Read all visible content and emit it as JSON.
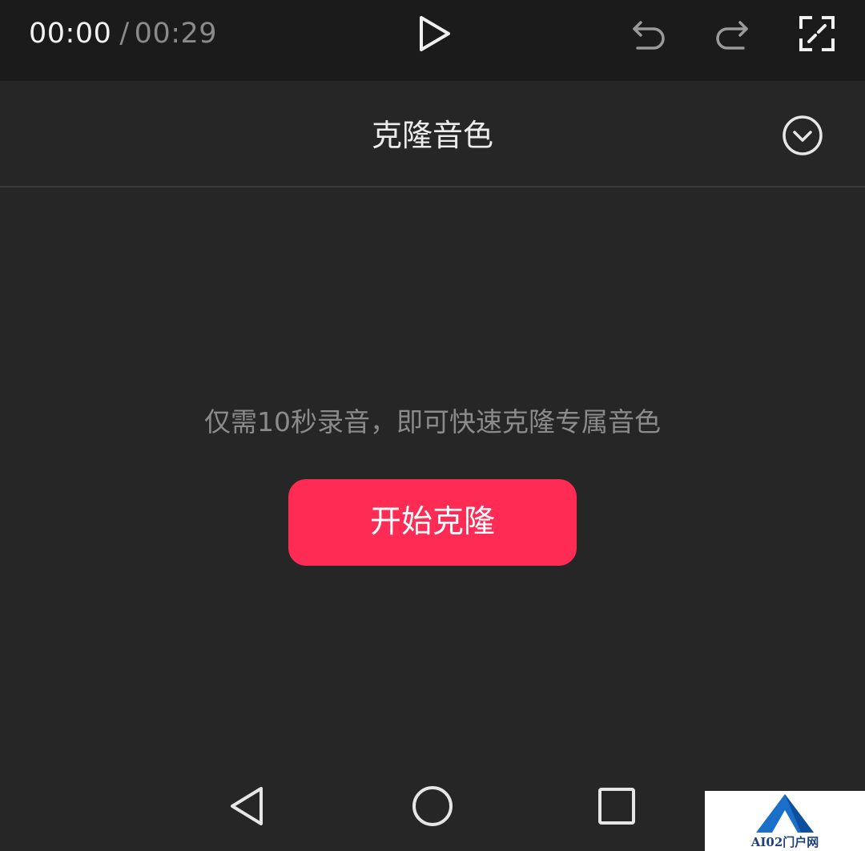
{
  "toolbar": {
    "current_time": "00:00",
    "separator": "/",
    "duration": "00:29",
    "icons": {
      "play": "play-icon",
      "undo": "undo-icon",
      "redo": "redo-icon",
      "fullscreen": "fullscreen-icon"
    }
  },
  "header": {
    "title": "克隆音色",
    "collapse_icon": "chevron-down-circle-icon"
  },
  "main": {
    "hint": "仅需10秒录音，即可快速克隆专属音色",
    "start_button_label": "开始克隆"
  },
  "navbar": {
    "back_icon": "back-triangle-icon",
    "home_icon": "home-circle-icon",
    "recent_icon": "recent-square-icon"
  },
  "watermark": {
    "text": "AI02门户网"
  },
  "colors": {
    "toolbar_bg": "#1b1b1b",
    "panel_bg": "#262626",
    "accent": "#fe2c55",
    "text_primary": "#ececec",
    "text_secondary": "#8b8b8b"
  }
}
